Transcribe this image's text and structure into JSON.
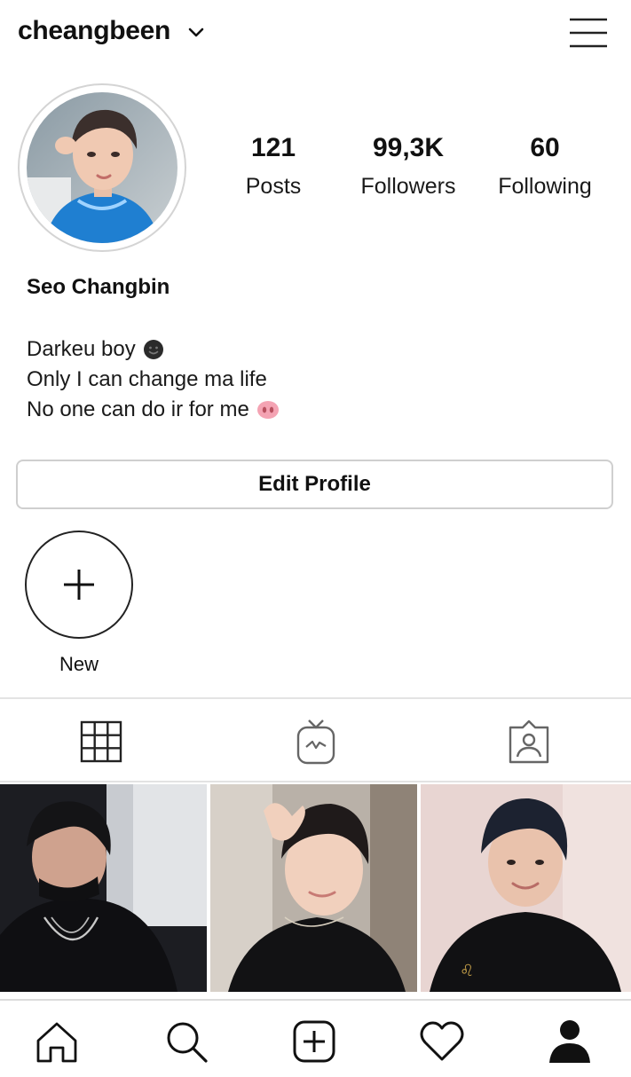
{
  "header": {
    "username": "cheangbeen",
    "chevron_icon": "chevron-down-icon",
    "menu_icon": "hamburger-menu-icon"
  },
  "profile": {
    "avatar_icon": "profile-avatar-photo",
    "stats": [
      {
        "value": "121",
        "label": "Posts"
      },
      {
        "value": "99,3K",
        "label": "Followers"
      },
      {
        "value": "60",
        "label": "Following"
      }
    ],
    "display_name": "Seo Changbin",
    "bio": [
      {
        "text": "Darkeu boy",
        "emoji": "dark-smiley-emoji"
      },
      {
        "text": "Only I can change ma life",
        "emoji": ""
      },
      {
        "text": "No one can do ir for me",
        "emoji": "pig-nose-emoji"
      }
    ],
    "edit_button": "Edit Profile"
  },
  "highlights": {
    "new_label": "New",
    "new_icon": "plus-icon"
  },
  "tabs": [
    {
      "icon": "grid-icon",
      "active": true
    },
    {
      "icon": "igtv-icon",
      "active": false
    },
    {
      "icon": "tagged-icon",
      "active": false
    }
  ],
  "posts": [
    {
      "icon": "post-photo-1"
    },
    {
      "icon": "post-photo-2"
    },
    {
      "icon": "post-photo-3"
    }
  ],
  "bottom_nav": [
    {
      "icon": "home-icon"
    },
    {
      "icon": "search-icon"
    },
    {
      "icon": "add-post-icon"
    },
    {
      "icon": "heart-icon"
    },
    {
      "icon": "profile-icon",
      "active": true
    }
  ],
  "colors": {
    "text": "#111111",
    "border": "#cfcfcf",
    "divider": "#e3e3e3",
    "icon_muted": "#555555"
  }
}
